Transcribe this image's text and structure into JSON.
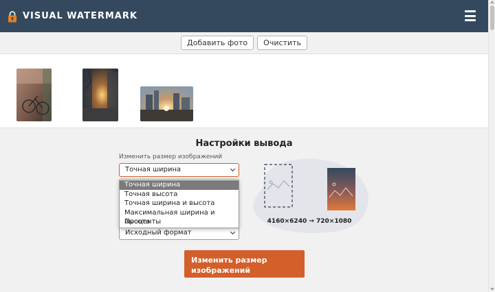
{
  "header": {
    "brand": "VISUAL WATERMARK",
    "logo_icon": "lock-icon",
    "menu_icon": "hamburger-menu-icon"
  },
  "toolbar": {
    "add_photo_label": "Добавить фото",
    "clear_label": "Очистить"
  },
  "gallery": {
    "images": [
      {
        "name": "photo-bicycle"
      },
      {
        "name": "photo-street-sunset"
      },
      {
        "name": "photo-city-sunset"
      }
    ]
  },
  "settings": {
    "title": "Настройки вывода",
    "resize_label": "Изменить размер изображений",
    "resize_selected": "Точная ширина",
    "resize_options": [
      "Точная ширина",
      "Точная высота",
      "Точная ширина и высота",
      "Максимальная ширина и высота",
      "Проценты"
    ],
    "format_selected": "Исходный формат",
    "dimensions": "4160×6240 → 720×1080",
    "submit_label": "Изменить размер изображений"
  },
  "colors": {
    "header_bg": "#34495e",
    "accent": "#d35f2b",
    "page_bg": "#f1f1f1"
  }
}
